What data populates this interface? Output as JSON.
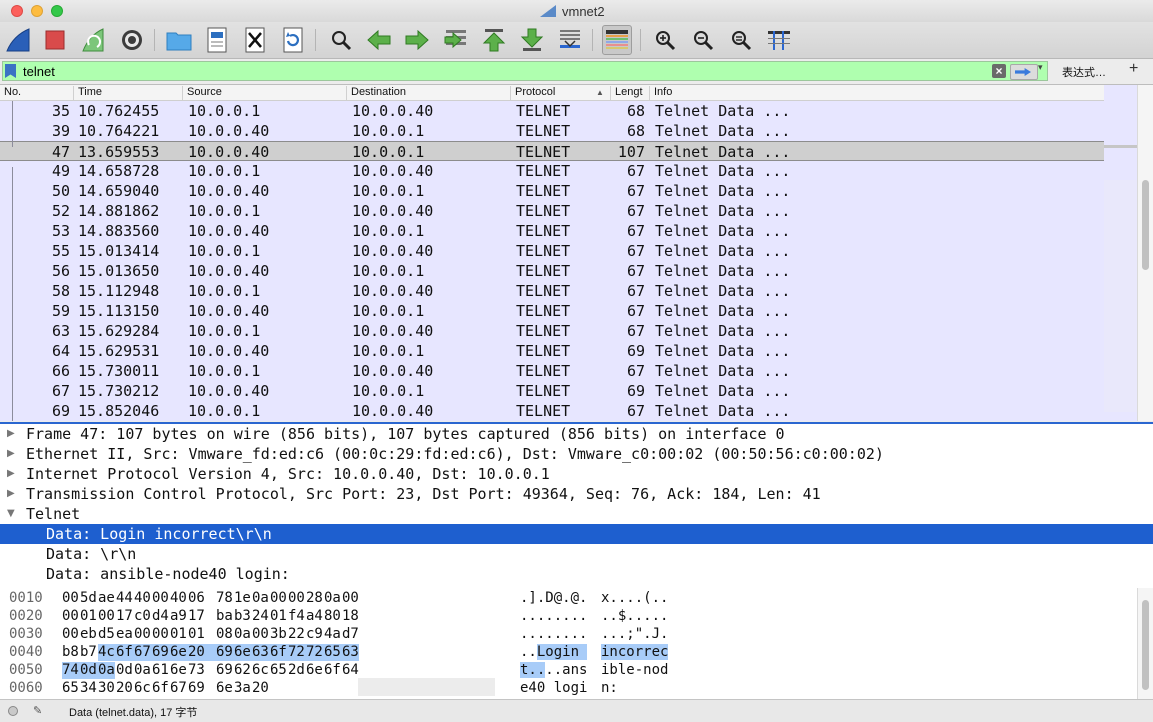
{
  "window": {
    "title": "vmnet2",
    "titlebar_watermark": ""
  },
  "toolbar": {
    "buttons": [
      {
        "name": "start-capture-fin-icon",
        "label": "Start capture"
      },
      {
        "name": "stop-capture-icon",
        "label": "Stop"
      },
      {
        "name": "restart-capture-icon",
        "label": "Restart"
      },
      {
        "name": "capture-options-gear-icon",
        "label": "Options"
      },
      {
        "name": "open-folder-icon",
        "label": "Open"
      },
      {
        "name": "save-file-icon",
        "label": "Save"
      },
      {
        "name": "close-file-icon",
        "label": "Close"
      },
      {
        "name": "reload-icon",
        "label": "Reload"
      },
      {
        "name": "find-packet-icon",
        "label": "Find"
      },
      {
        "name": "go-back-icon",
        "label": "Back"
      },
      {
        "name": "go-forward-icon",
        "label": "Forward"
      },
      {
        "name": "go-to-packet-icon",
        "label": "Go to"
      },
      {
        "name": "first-packet-icon",
        "label": "First"
      },
      {
        "name": "last-packet-icon",
        "label": "Last"
      },
      {
        "name": "autoscroll-icon",
        "label": "Autoscroll"
      },
      {
        "name": "colorize-icon",
        "label": "Colorize"
      },
      {
        "name": "zoom-in-icon",
        "label": "Zoom in"
      },
      {
        "name": "zoom-out-icon",
        "label": "Zoom out"
      },
      {
        "name": "normal-size-icon",
        "label": "Normal size"
      },
      {
        "name": "resize-columns-icon",
        "label": "Resize columns"
      }
    ]
  },
  "filter": {
    "value": "telnet",
    "expression_label": "表达式…",
    "plus_label": "+"
  },
  "packet_list": {
    "columns": [
      "No.",
      "Time",
      "Source",
      "Destination",
      "Protocol",
      "Lengt",
      "Info"
    ],
    "rows": [
      {
        "no": "35",
        "time": "10.762455",
        "src": "10.0.0.1",
        "dst": "10.0.0.40",
        "proto": "TELNET",
        "len": "68",
        "info": "Telnet Data ..."
      },
      {
        "no": "39",
        "time": "10.764221",
        "src": "10.0.0.40",
        "dst": "10.0.0.1",
        "proto": "TELNET",
        "len": "68",
        "info": "Telnet Data ..."
      },
      {
        "no": "47",
        "time": "13.659553",
        "src": "10.0.0.40",
        "dst": "10.0.0.1",
        "proto": "TELNET",
        "len": "107",
        "info": "Telnet Data ...",
        "selected": true
      },
      {
        "no": "49",
        "time": "14.658728",
        "src": "10.0.0.1",
        "dst": "10.0.0.40",
        "proto": "TELNET",
        "len": "67",
        "info": "Telnet Data ..."
      },
      {
        "no": "50",
        "time": "14.659040",
        "src": "10.0.0.40",
        "dst": "10.0.0.1",
        "proto": "TELNET",
        "len": "67",
        "info": "Telnet Data ..."
      },
      {
        "no": "52",
        "time": "14.881862",
        "src": "10.0.0.1",
        "dst": "10.0.0.40",
        "proto": "TELNET",
        "len": "67",
        "info": "Telnet Data ..."
      },
      {
        "no": "53",
        "time": "14.883560",
        "src": "10.0.0.40",
        "dst": "10.0.0.1",
        "proto": "TELNET",
        "len": "67",
        "info": "Telnet Data ..."
      },
      {
        "no": "55",
        "time": "15.013414",
        "src": "10.0.0.1",
        "dst": "10.0.0.40",
        "proto": "TELNET",
        "len": "67",
        "info": "Telnet Data ..."
      },
      {
        "no": "56",
        "time": "15.013650",
        "src": "10.0.0.40",
        "dst": "10.0.0.1",
        "proto": "TELNET",
        "len": "67",
        "info": "Telnet Data ..."
      },
      {
        "no": "58",
        "time": "15.112948",
        "src": "10.0.0.1",
        "dst": "10.0.0.40",
        "proto": "TELNET",
        "len": "67",
        "info": "Telnet Data ..."
      },
      {
        "no": "59",
        "time": "15.113150",
        "src": "10.0.0.40",
        "dst": "10.0.0.1",
        "proto": "TELNET",
        "len": "67",
        "info": "Telnet Data ..."
      },
      {
        "no": "63",
        "time": "15.629284",
        "src": "10.0.0.1",
        "dst": "10.0.0.40",
        "proto": "TELNET",
        "len": "67",
        "info": "Telnet Data ..."
      },
      {
        "no": "64",
        "time": "15.629531",
        "src": "10.0.0.40",
        "dst": "10.0.0.1",
        "proto": "TELNET",
        "len": "69",
        "info": "Telnet Data ..."
      },
      {
        "no": "66",
        "time": "15.730011",
        "src": "10.0.0.1",
        "dst": "10.0.0.40",
        "proto": "TELNET",
        "len": "67",
        "info": "Telnet Data ..."
      },
      {
        "no": "67",
        "time": "15.730212",
        "src": "10.0.0.40",
        "dst": "10.0.0.1",
        "proto": "TELNET",
        "len": "69",
        "info": "Telnet Data ..."
      },
      {
        "no": "69",
        "time": "15.852046",
        "src": "10.0.0.1",
        "dst": "10.0.0.40",
        "proto": "TELNET",
        "len": "67",
        "info": "Telnet Data ..."
      }
    ]
  },
  "details": {
    "rows": [
      {
        "text": "Frame 47: 107 bytes on wire (856 bits), 107 bytes captured (856 bits) on interface 0",
        "expander": "collapsed",
        "indent": 0
      },
      {
        "text": "Ethernet II, Src: Vmware_fd:ed:c6 (00:0c:29:fd:ed:c6), Dst: Vmware_c0:00:02 (00:50:56:c0:00:02)",
        "expander": "collapsed",
        "indent": 0
      },
      {
        "text": "Internet Protocol Version 4, Src: 10.0.0.40, Dst: 10.0.0.1",
        "expander": "collapsed",
        "indent": 0
      },
      {
        "text": "Transmission Control Protocol, Src Port: 23, Dst Port: 49364, Seq: 76, Ack: 184, Len: 41",
        "expander": "collapsed",
        "indent": 0
      },
      {
        "text": "Telnet",
        "expander": "expanded",
        "indent": 0
      },
      {
        "text": "Data: Login incorrect\\r\\n",
        "expander": "none",
        "indent": 1,
        "selected": true
      },
      {
        "text": "Data: \\r\\n",
        "expander": "none",
        "indent": 1
      },
      {
        "text": "Data: ansible-node40 login:",
        "expander": "none",
        "indent": 1
      }
    ]
  },
  "hex": {
    "rows": [
      {
        "offset": "0010",
        "bytes": [
          "00",
          "5d",
          "ae",
          "44",
          "40",
          "00",
          "40",
          "06",
          "78",
          "1e",
          "0a",
          "00",
          "00",
          "28",
          "0a",
          "00"
        ],
        "ascii_a": ".].D@.@.",
        "ascii_b": "x....(.."
      },
      {
        "offset": "0020",
        "bytes": [
          "00",
          "01",
          "00",
          "17",
          "c0",
          "d4",
          "a9",
          "17",
          "ba",
          "b3",
          "24",
          "01",
          "f4",
          "a4",
          "80",
          "18"
        ],
        "ascii_a": "........",
        "ascii_b": "..$....."
      },
      {
        "offset": "0030",
        "bytes": [
          "00",
          "eb",
          "d5",
          "ea",
          "00",
          "00",
          "01",
          "01",
          "08",
          "0a",
          "00",
          "3b",
          "22",
          "c9",
          "4a",
          "d7"
        ],
        "ascii_a": "........",
        "ascii_b": "...;\".J."
      },
      {
        "offset": "0040",
        "bytes": [
          "b8",
          "b7",
          "4c",
          "6f",
          "67",
          "69",
          "6e",
          "20",
          "69",
          "6e",
          "63",
          "6f",
          "72",
          "72",
          "65",
          "63"
        ],
        "ascii_a": "..Login ",
        "ascii_b": "incorrec"
      },
      {
        "offset": "0050",
        "bytes": [
          "74",
          "0d",
          "0a",
          "0d",
          "0a",
          "61",
          "6e",
          "73",
          "69",
          "62",
          "6c",
          "65",
          "2d",
          "6e",
          "6f",
          "64"
        ],
        "ascii_a": "t....ans",
        "ascii_b": "ible-nod"
      },
      {
        "offset": "0060",
        "bytes": [
          "65",
          "34",
          "30",
          "20",
          "6c",
          "6f",
          "67",
          "69",
          "6e",
          "3a",
          "20"
        ],
        "ascii_a": "e40 logi",
        "ascii_b": "n: "
      }
    ]
  },
  "status": {
    "text": "Data (telnet.data), 17 字节",
    "right": ""
  },
  "colors": {
    "accent": "#1e5fcf",
    "filter_bg": "#afffaf",
    "row_bg": "#e7e6ff",
    "hex_highlight": "#a8ccf8"
  }
}
